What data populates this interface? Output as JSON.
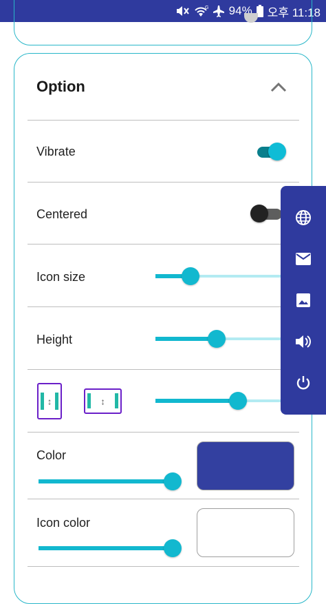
{
  "status_bar": {
    "battery": "94%",
    "time_label": "오후 11:18",
    "icons": [
      "mute-icon",
      "wifi-icon",
      "airplane-mode-icon",
      "battery-icon"
    ]
  },
  "option_card": {
    "title": "Option",
    "collapse_icon": "chevron-up-icon",
    "vibrate": {
      "label": "Vibrate",
      "on": true
    },
    "centered": {
      "label": "Centered",
      "on": false
    },
    "icon_size": {
      "label": "Icon size",
      "value": 0.28
    },
    "height": {
      "label": "Height",
      "value": 0.49
    },
    "orientation": {
      "icons": [
        "vertical-layout-icon",
        "horizontal-layout-icon"
      ],
      "value": 0.66
    },
    "color": {
      "label": "Color",
      "value": 1.0,
      "swatch": "#3340a0"
    },
    "icon_color": {
      "label": "Icon color",
      "value": 1.0,
      "swatch": "#ffffff"
    }
  },
  "side_panel": {
    "background": "#2f3a9e",
    "items": [
      "globe-icon",
      "mail-icon",
      "image-icon",
      "volume-icon",
      "power-icon"
    ]
  }
}
